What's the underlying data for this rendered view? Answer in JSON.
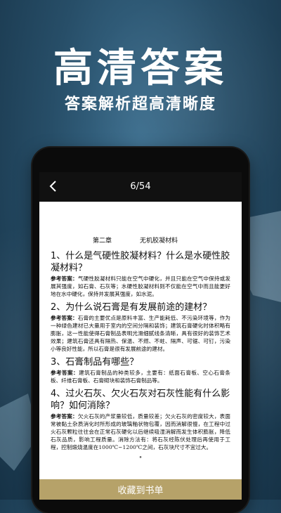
{
  "promo": {
    "headline": "高清答案",
    "subheadline": "答案解析超高清晰度"
  },
  "reader": {
    "page_indicator": "6/54",
    "chapter": {
      "number": "第二章",
      "title": "无机胶凝材料"
    },
    "items": [
      {
        "question": "1、什么是气硬性胶凝材料？什么是水硬性胶凝材料？",
        "answer_label": "参考答案：",
        "answer": "气硬性胶凝材料只能在空气中硬化，并且只能在空气中保持或发展其强度，如石膏、石灰等；水硬性胶凝材料则不仅能在空气中而且能更好地在水中硬化，保持并发展其强度，如水泥。"
      },
      {
        "question": "2、为什么说石膏是有发展前途的建材？",
        "answer_label": "参考答案：",
        "answer": "石膏的主要优点是原料丰富、生产能耗低、不污染环境等，作为一种绿色建材已大量用于室内的空间分隔和装饰；建筑石膏硬化时体积略有膨胀，这一性能使得石膏制品表明光滑细腻线条清晰，具有很好的装饰艺术效果；建筑石膏还具有隔热、保温、不燃、不蛀、隔声、可锯、可钉，污染小等良好性能，所以石膏是很有发展前途的建材。"
      },
      {
        "question": "3、石膏制品有哪些？",
        "answer_label": "参考答案：",
        "answer": "建筑石膏制品的种类较多，主要有：纸面石膏板、空心石膏条板、纤维石膏板、石膏砌块和装饰石膏制品等。"
      },
      {
        "question": "4、过火石灰、欠火石灰对石灰性能有什么影响？如何消除？",
        "answer_label": "参考答案：",
        "answer": "欠火石灰的产浆量较低，质量较差；欠火石灰的密度较大，表面常被黏土杂质消化时所形成的玻璃釉状物包覆，因而消解很慢，在工程中过火石灰颗粒往往会在正常石灰硬化以后继续吸湿消解而发生体积膨胀，降低石灰品质，影响工程质量。消除方法有：将石灰经陈伏处理后再使用于工程，控制煅烧温度在1000℃~1200℃之间，石灰块尺寸不宜过大。"
      }
    ],
    "page_dot": "•",
    "bottom_action": "收藏到书单"
  },
  "colors": {
    "background": "#274e68",
    "bottom_bar": "#b6a269",
    "topbar": "#111111"
  },
  "icons": {
    "back": "chevron-left-icon"
  }
}
